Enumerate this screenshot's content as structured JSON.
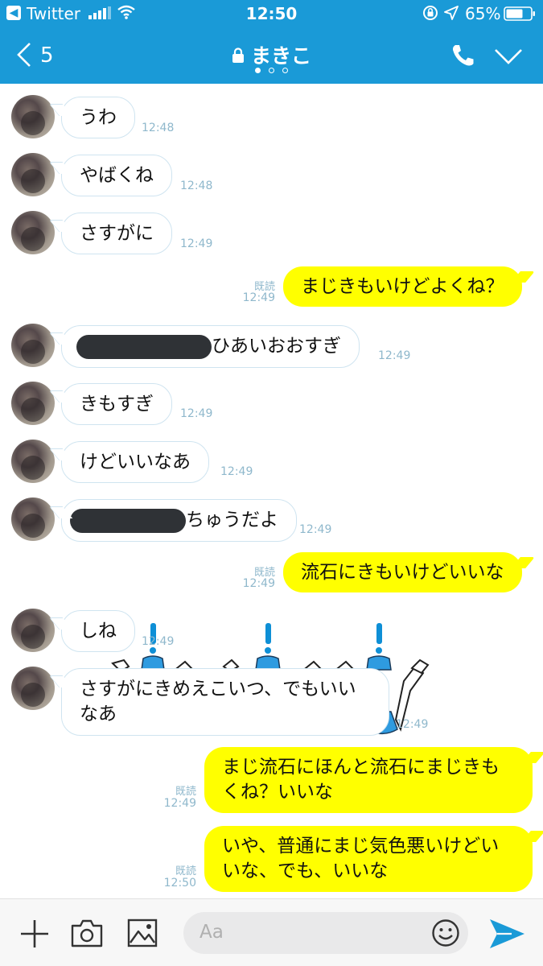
{
  "status_bar": {
    "back_app_glyph": "◀",
    "app": "Twitter",
    "time": "12:50",
    "battery": "65%"
  },
  "nav": {
    "back_count": "5",
    "title": "まきこ"
  },
  "messages": [
    {
      "dir": "in",
      "text": "うわ",
      "time": "12:48"
    },
    {
      "dir": "in",
      "text": "やばくね",
      "time": "12:48"
    },
    {
      "dir": "in",
      "text": "さすがに",
      "time": "12:49"
    },
    {
      "dir": "out",
      "text": "まじきもいけどよくね？",
      "read": "既読",
      "time": "12:49"
    },
    {
      "dir": "in",
      "text": "ひあいおおすぎ",
      "time": "12:49",
      "redacted": true
    },
    {
      "dir": "in",
      "text": "きもすぎ",
      "time": "12:49"
    },
    {
      "dir": "in",
      "text": "けどいいなあ",
      "time": "12:49"
    },
    {
      "dir": "in",
      "text": "ちゅうだよ",
      "time": "12:49",
      "redacted": true
    },
    {
      "dir": "out",
      "text": "流石にきもいけどいいな",
      "read": "既読",
      "time": "12:49"
    },
    {
      "dir": "in",
      "text": "しね",
      "time": "12:49"
    },
    {
      "dir": "in",
      "text_line1": "さすがにきめえこいつ、でもいい",
      "text_line2": "なあ",
      "time": "12:49"
    },
    {
      "dir": "out",
      "text_line1": "まじ流石にほんと流石にまじきも",
      "text_line2": "くね？いいな",
      "read": "既読",
      "time": "12:49"
    },
    {
      "dir": "out",
      "text_line1": "いや、普通にまじ気色悪いけどい",
      "text_line2": "いな、でも、いいな",
      "read": "既読",
      "time": "12:50"
    }
  ],
  "input": {
    "placeholder": "Aa"
  },
  "icons": [
    "back-chevron-icon",
    "lock-icon",
    "phone-icon",
    "chevron-down-icon",
    "plus-icon",
    "camera-icon",
    "image-icon",
    "emoji-icon",
    "send-icon"
  ],
  "colors": {
    "header": "#1a9ad7",
    "outgoing_bubble": "#ffff00",
    "incoming_border": "#cfe4f0",
    "timestamp": "#8fb8cc",
    "send": "#1a9ad7"
  }
}
